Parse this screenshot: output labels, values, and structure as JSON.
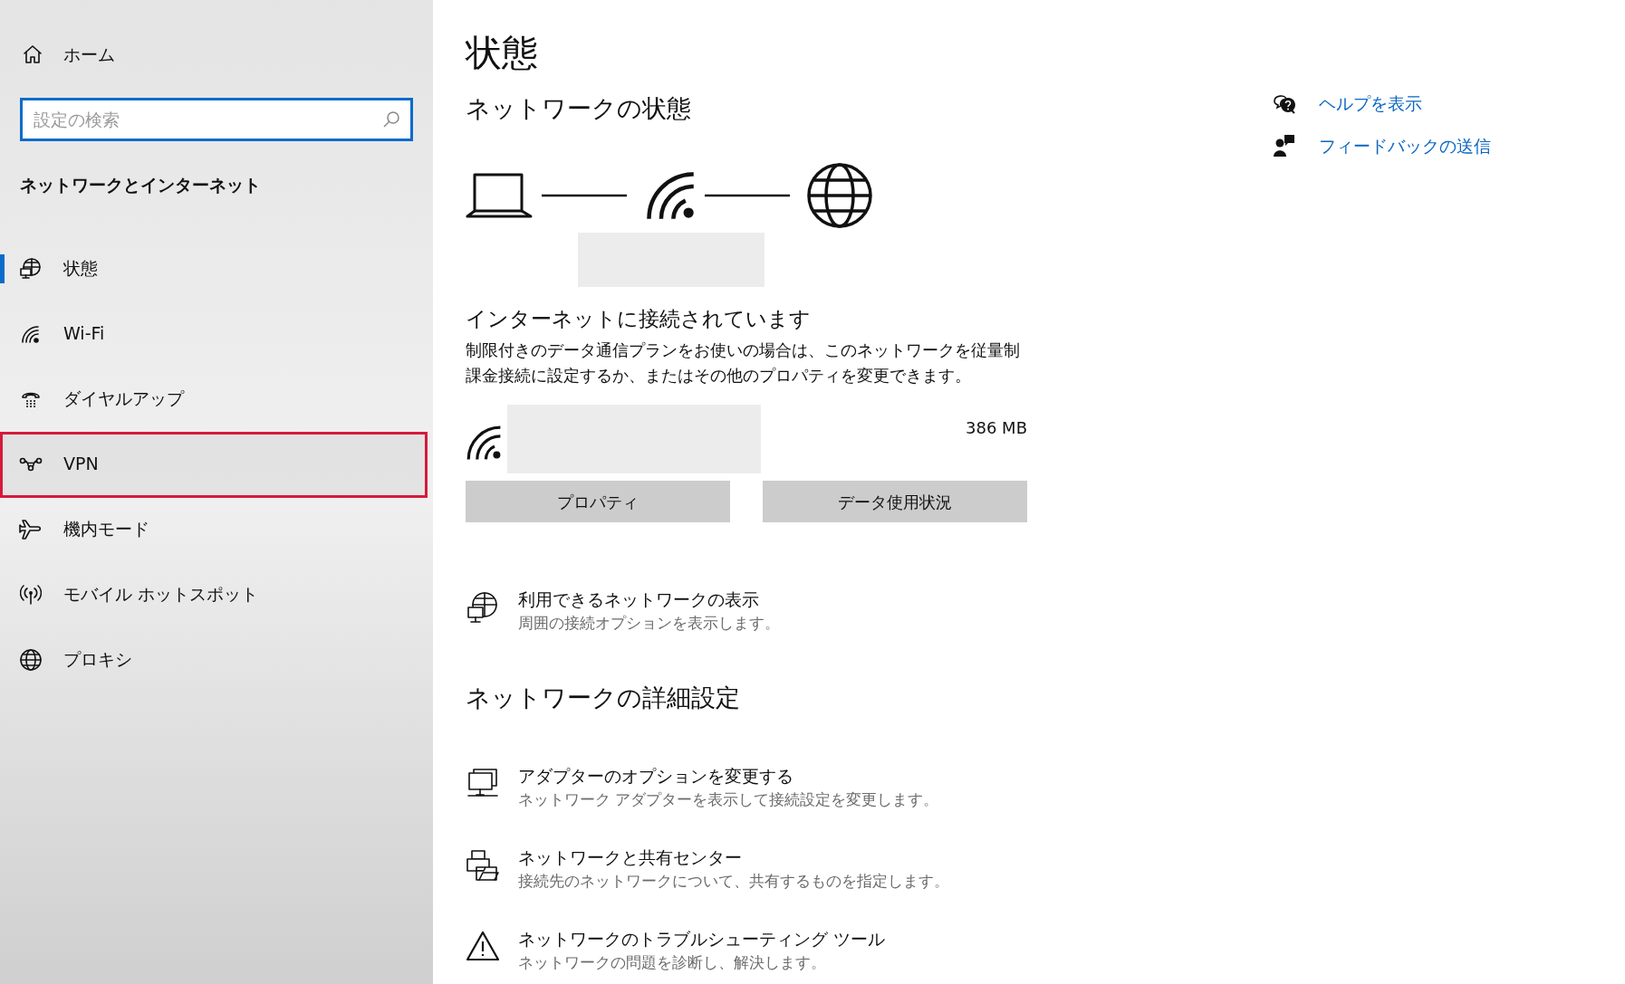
{
  "sidebar": {
    "home": "ホーム",
    "search": {
      "placeholder": "設定の検索"
    },
    "section_title": "ネットワークとインターネット",
    "items": [
      {
        "label": "状態",
        "selected": true,
        "highlighted": false
      },
      {
        "label": "Wi-Fi",
        "selected": false,
        "highlighted": false
      },
      {
        "label": "ダイヤルアップ",
        "selected": false,
        "highlighted": false
      },
      {
        "label": "VPN",
        "selected": false,
        "highlighted": true
      },
      {
        "label": "機内モード",
        "selected": false,
        "highlighted": false
      },
      {
        "label": "モバイル ホットスポット",
        "selected": false,
        "highlighted": false
      },
      {
        "label": "プロキシ",
        "selected": false,
        "highlighted": false
      }
    ]
  },
  "main": {
    "title": "状態",
    "network_status_heading": "ネットワークの状態",
    "connection_status": "インターネットに接続されています",
    "description": "制限付きのデータ通信プランをお使いの場合は、このネットワークを従量制課金接続に設定するか、またはその他のプロパティを変更できます。",
    "data_usage": "386 MB",
    "buttons": [
      "プロパティ",
      "データ使用状況"
    ],
    "available_networks": {
      "title": "利用できるネットワークの表示",
      "subtitle": "周囲の接続オプションを表示します。"
    },
    "advanced_heading": "ネットワークの詳細設定",
    "advanced_items": [
      {
        "title": "アダプターのオプションを変更する",
        "subtitle": "ネットワーク アダプターを表示して接続設定を変更します。"
      },
      {
        "title": "ネットワークと共有センター",
        "subtitle": "接続先のネットワークについて、共有するものを指定します。"
      },
      {
        "title": "ネットワークのトラブルシューティング ツール",
        "subtitle": "ネットワークの問題を診断し、解決します。"
      }
    ]
  },
  "help_links": [
    "ヘルプを表示",
    "フィードバックの送信"
  ]
}
